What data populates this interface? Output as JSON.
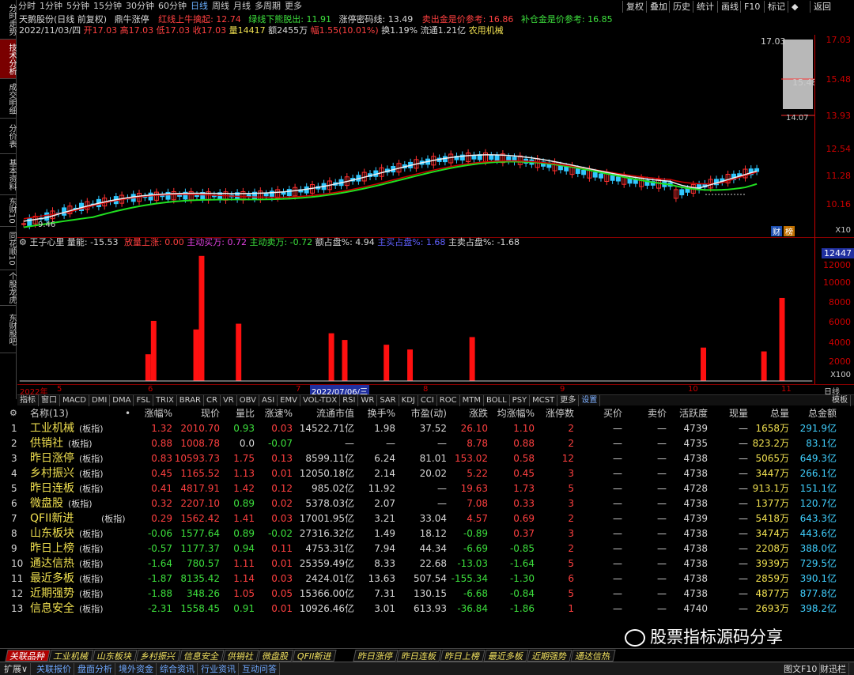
{
  "side_tabs": [
    {
      "label": "分时走势"
    },
    {
      "label": "技术分析"
    },
    {
      "label": "成交明细"
    },
    {
      "label": "分价表"
    },
    {
      "label": "基本资料"
    },
    {
      "label": "东财10"
    },
    {
      "label": "同花顺10"
    },
    {
      "label": "个股龙虎"
    },
    {
      "label": "东财股吧"
    }
  ],
  "timeframes": [
    "分时",
    "1分钟",
    "5分钟",
    "15分钟",
    "30分钟",
    "60分钟",
    "日线",
    "周线",
    "月线",
    "多周期",
    "更多"
  ],
  "active_timeframe": "日线",
  "top_buttons": [
    "复权",
    "叠加",
    "历史",
    "统计",
    "画线",
    "F10",
    "标记",
    "◆",
    "返回"
  ],
  "header": {
    "stock": "天鹅股份(日线 前复权)",
    "indicator": "鼎牛涨停",
    "red_line": "红线上牛擒起: 12.74",
    "green_line": "绿线下熊脱出: 11.91",
    "zt_line": "涨停密码线: 13.49",
    "sell_ref": "卖出金是价参考: 16.86",
    "buy_ref": "补仓金是价参考: 16.85"
  },
  "ohlc": {
    "date": "2022/11/03/四",
    "open": "开17.03",
    "high": "高17.03",
    "low": "低17.03",
    "close": "收17.03",
    "vol": "量14417",
    "amount": "额2455万",
    "change": "幅1.55(10.01%)",
    "turnover": "换1.19%",
    "float": "流通1.21亿",
    "industry": "农用机械"
  },
  "price_axis": [
    "17.03",
    "15.48",
    "13.93",
    "12.54",
    "11.28",
    "10.16"
  ],
  "price_labels": {
    "high": "17.03",
    "mid": "15.48",
    "marker": "14.07",
    "low": "9.46",
    "x10": "X10",
    "cai": "财",
    "bang": "榜"
  },
  "indicator_header": {
    "name": "王子心里",
    "energy": "量能: -15.53",
    "vol_up": "放量上涨: 0.00",
    "active_buy": "主动买万: 0.72",
    "active_sell": "主动卖万: -0.72",
    "buy_pct": "额占盘%: 4.94",
    "main_buy": "主买占盘%: 1.68",
    "main_sell": "主卖占盘%: -1.68"
  },
  "ind_axis": [
    "12447",
    "12000",
    "10000",
    "8000",
    "6000",
    "4000",
    "2000",
    "X100"
  ],
  "ind_bars": [
    2800,
    6300,
    5400,
    13100,
    6000,
    5000,
    4300,
    3800,
    3300,
    4600,
    3500,
    3100,
    8700
  ],
  "date_axis": [
    "2022年",
    "5",
    "6",
    "7",
    "2022/07/06/三",
    "8",
    "9",
    "10",
    "11",
    "日线"
  ],
  "indicator_tabs": [
    "指标",
    "窗口",
    "MACD",
    "DMI",
    "DMA",
    "FSL",
    "TRIX",
    "BRAR",
    "CR",
    "VR",
    "OBV",
    "ASI",
    "EMV",
    "VOL-TDX",
    "RSI",
    "WR",
    "SAR",
    "KDJ",
    "CCI",
    "ROC",
    "MTM",
    "BOLL",
    "PSY",
    "MCST",
    "更多",
    "设置"
  ],
  "indicator_right": "模板",
  "table": {
    "headers": [
      "名称(13)",
      "•",
      "涨幅%",
      "现价",
      "量比",
      "涨速%",
      "流通市值",
      "换手%",
      "市盈(动)",
      "涨跌",
      "均涨幅%",
      "涨停数",
      "买价",
      "卖价",
      "活跃度",
      "现量",
      "总量",
      "总金额"
    ],
    "rows": [
      {
        "n": "1",
        "name": "工业机械",
        "tag": "(板指)",
        "chg": "1.32",
        "price": "2010.70",
        "lb": "0.93",
        "spd": "0.03",
        "cap": "14522.71亿",
        "turn": "1.98",
        "pe": "37.52",
        "diff": "26.10",
        "avg": "1.10",
        "zt": "2",
        "buy": "—",
        "sell": "—",
        "act": "4739",
        "cur": "—",
        "vol": "1658万",
        "amt": "291.9亿"
      },
      {
        "n": "2",
        "name": "供销社",
        "tag": "(板指)",
        "chg": "0.88",
        "price": "1008.78",
        "lb": "0.0",
        "spd": "-0.07",
        "cap": "—",
        "turn": "—",
        "pe": "—",
        "diff": "8.78",
        "avg": "0.88",
        "zt": "2",
        "buy": "—",
        "sell": "—",
        "act": "4735",
        "cur": "—",
        "vol": "823.2万",
        "amt": "83.1亿"
      },
      {
        "n": "3",
        "name": "昨日涨停",
        "tag": "(板指)",
        "chg": "0.83",
        "price": "10593.73",
        "lb": "1.75",
        "spd": "0.13",
        "cap": "8599.11亿",
        "turn": "6.24",
        "pe": "81.01",
        "diff": "153.02",
        "avg": "0.58",
        "zt": "12",
        "buy": "—",
        "sell": "—",
        "act": "4738",
        "cur": "—",
        "vol": "5065万",
        "amt": "649.3亿"
      },
      {
        "n": "4",
        "name": "乡村振兴",
        "tag": "(板指)",
        "chg": "0.45",
        "price": "1165.52",
        "lb": "1.13",
        "spd": "0.01",
        "cap": "12050.18亿",
        "turn": "2.14",
        "pe": "20.02",
        "diff": "5.22",
        "avg": "0.45",
        "zt": "3",
        "buy": "—",
        "sell": "—",
        "act": "4738",
        "cur": "—",
        "vol": "3447万",
        "amt": "266.1亿"
      },
      {
        "n": "5",
        "name": "昨日连板",
        "tag": "(板指)",
        "chg": "0.41",
        "price": "4817.91",
        "lb": "1.42",
        "spd": "0.12",
        "cap": "985.02亿",
        "turn": "11.92",
        "pe": "—",
        "diff": "19.63",
        "avg": "1.73",
        "zt": "5",
        "buy": "—",
        "sell": "—",
        "act": "4728",
        "cur": "—",
        "vol": "913.1万",
        "amt": "151.1亿"
      },
      {
        "n": "6",
        "name": "微盘股",
        "tag": "(板指)",
        "chg": "0.32",
        "price": "2207.10",
        "lb": "0.89",
        "spd": "0.02",
        "cap": "5378.03亿",
        "turn": "2.07",
        "pe": "—",
        "diff": "7.08",
        "avg": "0.33",
        "zt": "3",
        "buy": "—",
        "sell": "—",
        "act": "4738",
        "cur": "—",
        "vol": "1377万",
        "amt": "120.7亿"
      },
      {
        "n": "7",
        "name": "QFII新进",
        "tag": "(板指)",
        "chg": "0.29",
        "price": "1562.42",
        "lb": "1.41",
        "spd": "0.03",
        "cap": "17001.95亿",
        "turn": "3.21",
        "pe": "33.04",
        "diff": "4.57",
        "avg": "0.69",
        "zt": "2",
        "buy": "—",
        "sell": "—",
        "act": "4739",
        "cur": "—",
        "vol": "5418万",
        "amt": "643.3亿"
      },
      {
        "n": "8",
        "name": "山东板块",
        "tag": "(板指)",
        "chg": "-0.06",
        "price": "1577.64",
        "lb": "0.89",
        "spd": "-0.02",
        "cap": "27316.32亿",
        "turn": "1.49",
        "pe": "18.12",
        "diff": "-0.89",
        "avg": "0.37",
        "zt": "3",
        "buy": "—",
        "sell": "—",
        "act": "4738",
        "cur": "—",
        "vol": "3474万",
        "amt": "443.6亿"
      },
      {
        "n": "9",
        "name": "昨日上榜",
        "tag": "(板指)",
        "chg": "-0.57",
        "price": "1177.37",
        "lb": "0.94",
        "spd": "0.11",
        "cap": "4753.31亿",
        "turn": "7.94",
        "pe": "44.34",
        "diff": "-6.69",
        "avg": "-0.85",
        "zt": "2",
        "buy": "—",
        "sell": "—",
        "act": "4738",
        "cur": "—",
        "vol": "2208万",
        "amt": "388.0亿"
      },
      {
        "n": "10",
        "name": "通达信热",
        "tag": "(板指)",
        "chg": "-1.64",
        "price": "780.57",
        "lb": "1.11",
        "spd": "0.01",
        "cap": "25359.49亿",
        "turn": "8.33",
        "pe": "22.68",
        "diff": "-13.03",
        "avg": "-1.64",
        "zt": "5",
        "buy": "—",
        "sell": "—",
        "act": "4738",
        "cur": "—",
        "vol": "3939万",
        "amt": "729.5亿"
      },
      {
        "n": "11",
        "name": "最近多板",
        "tag": "(板指)",
        "chg": "-1.87",
        "price": "8135.42",
        "lb": "1.14",
        "spd": "0.03",
        "cap": "2424.01亿",
        "turn": "13.63",
        "pe": "507.54",
        "diff": "-155.34",
        "avg": "-1.30",
        "zt": "6",
        "buy": "—",
        "sell": "—",
        "act": "4738",
        "cur": "—",
        "vol": "2859万",
        "amt": "390.1亿"
      },
      {
        "n": "12",
        "name": "近期强势",
        "tag": "(板指)",
        "chg": "-1.88",
        "price": "348.26",
        "lb": "1.05",
        "spd": "0.05",
        "cap": "15366.00亿",
        "turn": "7.31",
        "pe": "130.15",
        "diff": "-6.68",
        "avg": "-0.84",
        "zt": "5",
        "buy": "—",
        "sell": "—",
        "act": "4738",
        "cur": "—",
        "vol": "4877万",
        "amt": "877.8亿"
      },
      {
        "n": "13",
        "name": "信息安全",
        "tag": "(板指)",
        "chg": "-2.31",
        "price": "1558.45",
        "lb": "0.91",
        "spd": "0.01",
        "cap": "10926.46亿",
        "turn": "3.01",
        "pe": "613.93",
        "diff": "-36.84",
        "avg": "-1.86",
        "zt": "1",
        "buy": "—",
        "sell": "—",
        "act": "4740",
        "cur": "—",
        "vol": "2693万",
        "amt": "398.2亿"
      }
    ]
  },
  "bottom_tabs": [
    "关联品种",
    "工业机械",
    "山东板块",
    "乡村振兴",
    "信息安全",
    "供销社",
    "微盘股",
    "QFII新进",
    "昨日涨停",
    "昨日连板",
    "昨日上榜",
    "最近多板",
    "近期强势",
    "通达信热"
  ],
  "status_items": [
    "扩展∨",
    "关联报价",
    "盘面分析",
    "境外资金",
    "综合资讯",
    "行业资讯",
    "互动问答"
  ],
  "status_right": [
    "图文F10",
    "财迅栏"
  ],
  "watermark": "股票指标源码分享",
  "colors": {
    "up": "#ff4040",
    "down": "#3de03d",
    "accent": "#b00000"
  }
}
